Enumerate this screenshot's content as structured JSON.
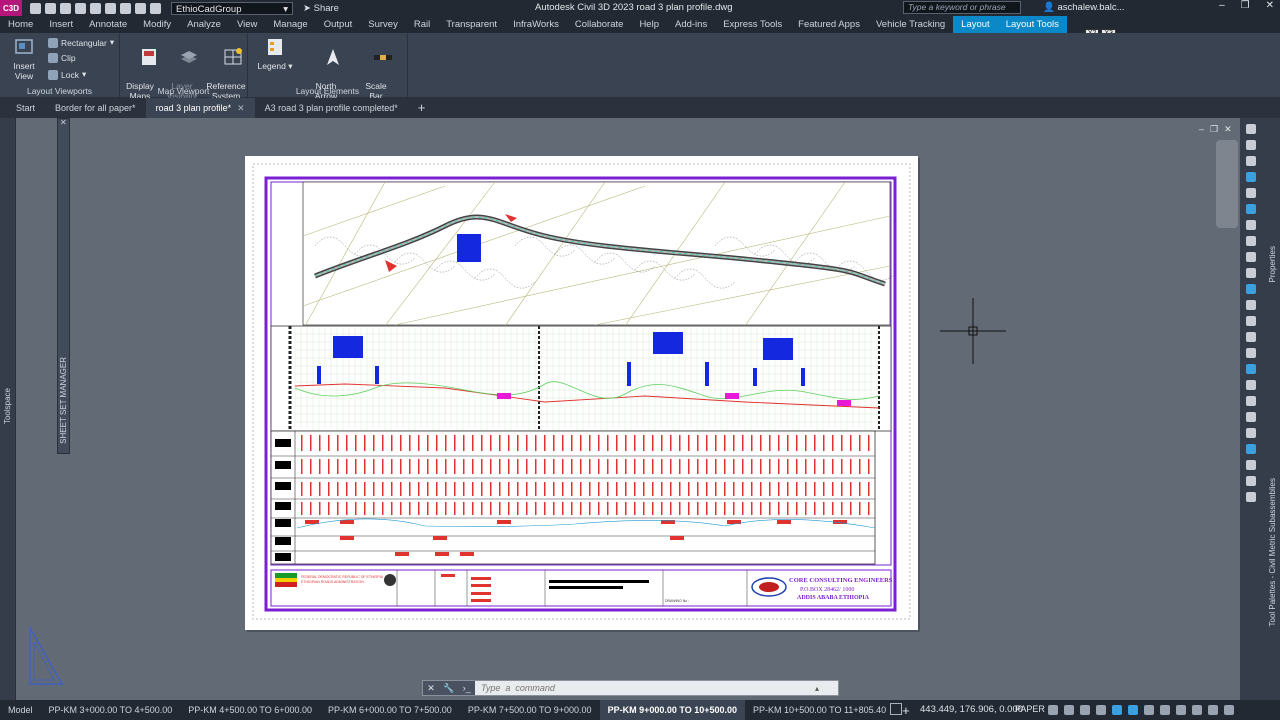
{
  "app": {
    "logo_text": "C3D",
    "title": "Autodesk Civil 3D 2023   road 3 plan profile.dwg",
    "workspace": "EthioCadGroup",
    "share_label": "Share",
    "search_placeholder": "Type a keyword or phrase",
    "user": "aschalew.balc...",
    "window_buttons": [
      "–",
      "❐",
      "✕"
    ]
  },
  "menu": [
    {
      "label": "Home",
      "key": "H"
    },
    {
      "label": "Insert",
      "key": "IN"
    },
    {
      "label": "Annotate",
      "key": "AN"
    },
    {
      "label": "Modify",
      "key": "MD"
    },
    {
      "label": "Analyze",
      "key": "Z"
    },
    {
      "label": "View",
      "key": "V"
    },
    {
      "label": "Manage",
      "key": "MA"
    },
    {
      "label": "Output",
      "key": "O"
    },
    {
      "label": "Survey",
      "key": "SO"
    },
    {
      "label": "Rail",
      "key": "RA"
    },
    {
      "label": "Transparent",
      "key": "TC"
    },
    {
      "label": "InfraWorks",
      "key": ""
    },
    {
      "label": "Collaborate",
      "key": ""
    },
    {
      "label": "Help",
      "key": "E"
    },
    {
      "label": "Add-ins",
      "key": "AD"
    },
    {
      "label": "Express Tools",
      "key": "ET"
    },
    {
      "label": "Featured Apps",
      "key": "AP"
    },
    {
      "label": "Vehicle Tracking",
      "key": ""
    },
    {
      "label": "Layout",
      "key": "L",
      "active": true
    },
    {
      "label": "Layout Tools",
      "key": "LT",
      "active": true
    }
  ],
  "extra_keytips": [
    "X2",
    "X3"
  ],
  "ribbon": {
    "layout_viewports": {
      "title": "Layout Viewports",
      "insert_view": "Insert View",
      "rectangular": "Rectangular",
      "clip": "Clip",
      "lock": "Lock"
    },
    "map_viewport": {
      "title": "Map Viewport",
      "display_maps": "Display\nMaps",
      "layer_visibility": "Layer\nVisibility",
      "reference_system": "Reference\nSystem"
    },
    "layout_elements": {
      "title": "Layout Elements",
      "legend": "Legend",
      "north_arrow": "North\nArrow",
      "scale_bar": "Scale\nBar"
    }
  },
  "doc_tabs": [
    {
      "label": "Start"
    },
    {
      "label": "Border for all paper*"
    },
    {
      "label": "road 3 plan profile*",
      "active": true
    },
    {
      "label": "A3 road 3 plan profile completed*"
    }
  ],
  "side_labels": {
    "toolspace": "Toolspace",
    "sheet_set_manager": "SHEET SET MANAGER",
    "properties": "Properties",
    "tool_palettes": "Tool Palettes - Civil Metric Subassemblies"
  },
  "titleblock": {
    "company": "CORE CONSULTING ENGINEERS",
    "po_box": "P.O.BOX 28462/ 1000",
    "city": "ADDIS ABABA ETHIOPIA",
    "client": "FEDERAL DEMOCRATIC REPUBLIC OF ETHIOPIA",
    "authority": "ETHIOPIAN ROADS ADMINISTRATION",
    "drawing_no": "DRAWING No :"
  },
  "command": {
    "placeholder": "Type  a  command"
  },
  "layout_tabs": [
    {
      "label": "Model"
    },
    {
      "label": "PP-KM 3+000.00 TO 4+500.00"
    },
    {
      "label": "PP-KM 4+500.00 TO 6+000.00"
    },
    {
      "label": "PP-KM 6+000.00 TO 7+500.00"
    },
    {
      "label": "PP-KM 7+500.00 TO 9+000.00"
    },
    {
      "label": "PP-KM 9+000.00 TO 10+500.00",
      "active": true
    },
    {
      "label": "PP-KM 10+500.00 TO 11+805.40"
    }
  ],
  "status": {
    "coordinates": "443.449, 176.906, 0.000",
    "space": "PAPER"
  },
  "colors": {
    "border_purple": "#7a1fd1",
    "profile_red": "#e0322f",
    "structure_blue": "#1428e0",
    "magenta": "#e81ad8",
    "grid_green": "#5fd05f",
    "accent": "#0a88c8"
  }
}
